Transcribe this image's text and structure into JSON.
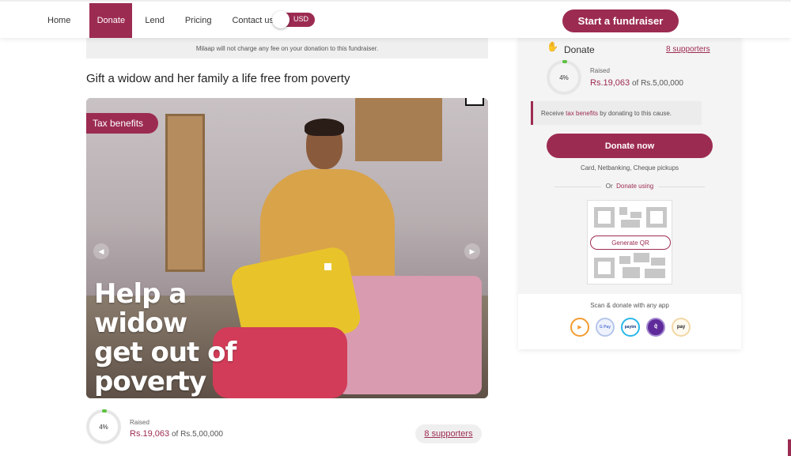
{
  "nav": {
    "items": [
      {
        "label": "Home"
      },
      {
        "label": "Donate"
      },
      {
        "label": "Lend"
      },
      {
        "label": "Pricing"
      },
      {
        "label": "Contact us"
      }
    ],
    "active_index": 1,
    "currency_toggle": "USD",
    "cta": "Start a fundraiser"
  },
  "fee_notice": "Milaap will not charge any fee on your donation to this fundraiser.",
  "campaign": {
    "title": "Gift a widow and her family a life free from poverty",
    "tag": "Tax benefits",
    "image_overlay_text": "Help a\nwidow\nget out of\npoverty"
  },
  "progress": {
    "percent_label": "4%",
    "percent": 4,
    "raised_label": "Raised",
    "raised_amount": "Rs.19,063",
    "of_label": "of",
    "goal_amount": "Rs.5,00,000",
    "supporters": "8 supporters"
  },
  "sidebar": {
    "donate_title": "Donate",
    "tax_note_pre": "Receive ",
    "tax_note_link": "tax benefits",
    "tax_note_post": " by donating to this cause.",
    "donate_now": "Donate now",
    "methods": "Card, Netbanking, Cheque pickups",
    "or_prefix": "Or ",
    "or_link": "Donate using",
    "generate_qr": "Generate QR",
    "scan_text": "Scan & donate with any app",
    "apps": [
      {
        "name": "bhim-app-icon",
        "glyph": "▶"
      },
      {
        "name": "google-pay-icon",
        "glyph": "G Pay"
      },
      {
        "name": "paytm-icon",
        "glyph": "paytm"
      },
      {
        "name": "phonepe-icon",
        "glyph": "पे"
      },
      {
        "name": "amazon-pay-icon",
        "glyph": "pay"
      }
    ]
  },
  "colors": {
    "brand": "#9c2b52",
    "progress": "#5ac23d"
  }
}
